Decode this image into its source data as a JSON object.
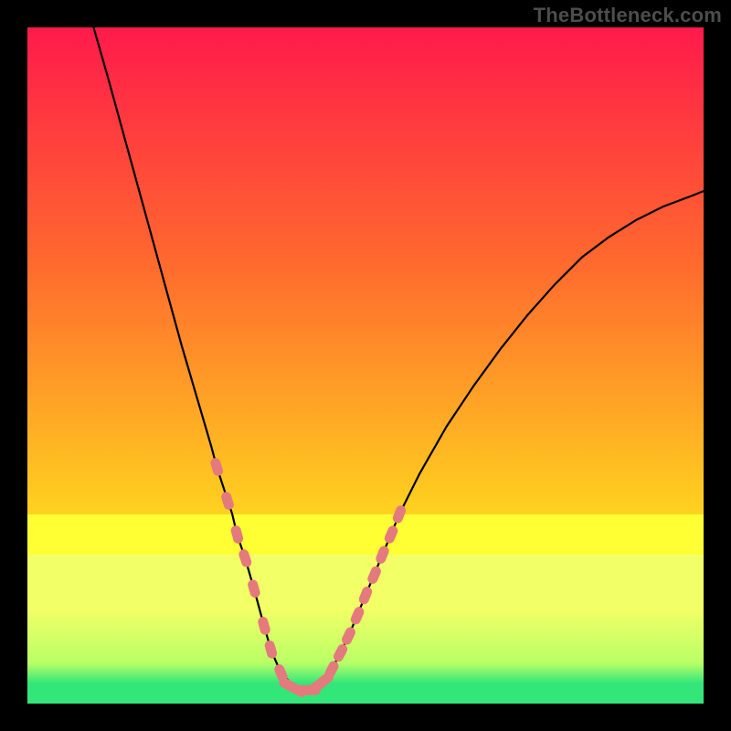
{
  "watermark": "TheBottleneck.com",
  "colors": {
    "frame": "#000000",
    "grad_top": "#ff1a4b",
    "grad_mid1": "#ff6a2e",
    "grad_mid2": "#ffd21f",
    "grad_yellow": "#ffff33",
    "grad_lemon": "#f2ff66",
    "grad_lime": "#b9ff66",
    "grad_green": "#33e67a",
    "curve": "#000000",
    "dots": "#e47a7d"
  },
  "chart_data": {
    "type": "line",
    "title": "",
    "xlabel": "",
    "ylabel": "",
    "xlim": [
      0,
      100
    ],
    "ylim": [
      0,
      100
    ],
    "series": [
      {
        "name": "curve",
        "x": [
          9.5,
          11.8,
          14.0,
          16.2,
          18.4,
          20.6,
          22.8,
          25.0,
          27.2,
          28.0,
          30.3,
          31.0,
          32.2,
          33.5,
          35.0,
          36.0,
          37.5,
          40.0,
          42.0,
          44.0,
          45.0,
          47.5,
          50.0,
          52.5,
          55.0,
          58.0,
          62.0,
          66.0,
          70.0,
          74.0,
          78.0,
          82.0,
          86.0,
          90.0,
          94.0,
          98.0,
          100.0
        ],
        "y": [
          101.0,
          93.0,
          85.0,
          77.0,
          69.0,
          61.0,
          53.0,
          45.5,
          38.0,
          35.0,
          28.0,
          25.0,
          21.5,
          17.0,
          11.5,
          8.0,
          4.5,
          2.0,
          2.0,
          3.5,
          5.0,
          10.0,
          16.0,
          22.0,
          28.0,
          34.0,
          41.0,
          47.0,
          52.5,
          57.5,
          62.0,
          66.0,
          69.0,
          71.5,
          73.5,
          75.0,
          75.8
        ]
      }
    ],
    "markers": [
      {
        "name": "dots-left",
        "x": [
          28.0,
          29.6,
          31.0,
          32.2,
          33.5,
          35.0,
          36.0,
          37.5
        ],
        "y": [
          35.0,
          30.0,
          25.0,
          21.5,
          17.0,
          11.5,
          8.0,
          4.5
        ]
      },
      {
        "name": "dots-bottom",
        "x": [
          38.5,
          40.0,
          41.0,
          42.0,
          43.0,
          44.0
        ],
        "y": [
          2.8,
          2.0,
          2.0,
          2.0,
          2.7,
          3.5
        ]
      },
      {
        "name": "dots-right",
        "x": [
          45.0,
          46.3,
          47.5,
          48.8,
          50.0,
          51.3,
          52.5,
          53.8,
          55.0
        ],
        "y": [
          5.0,
          7.5,
          10.0,
          13.0,
          16.0,
          19.0,
          22.0,
          25.0,
          28.0
        ]
      }
    ],
    "gradient_bands": [
      {
        "y_from": 100,
        "y_to": 28,
        "role": "red-orange-yellow-vertical-gradient"
      },
      {
        "y_from": 28,
        "y_to": 22,
        "role": "bright-yellow"
      },
      {
        "y_from": 22,
        "y_to": 14,
        "role": "lemon"
      },
      {
        "y_from": 14,
        "y_to": 3,
        "role": "yellow-green-transition"
      },
      {
        "y_from": 3,
        "y_to": 0,
        "role": "green"
      }
    ]
  }
}
